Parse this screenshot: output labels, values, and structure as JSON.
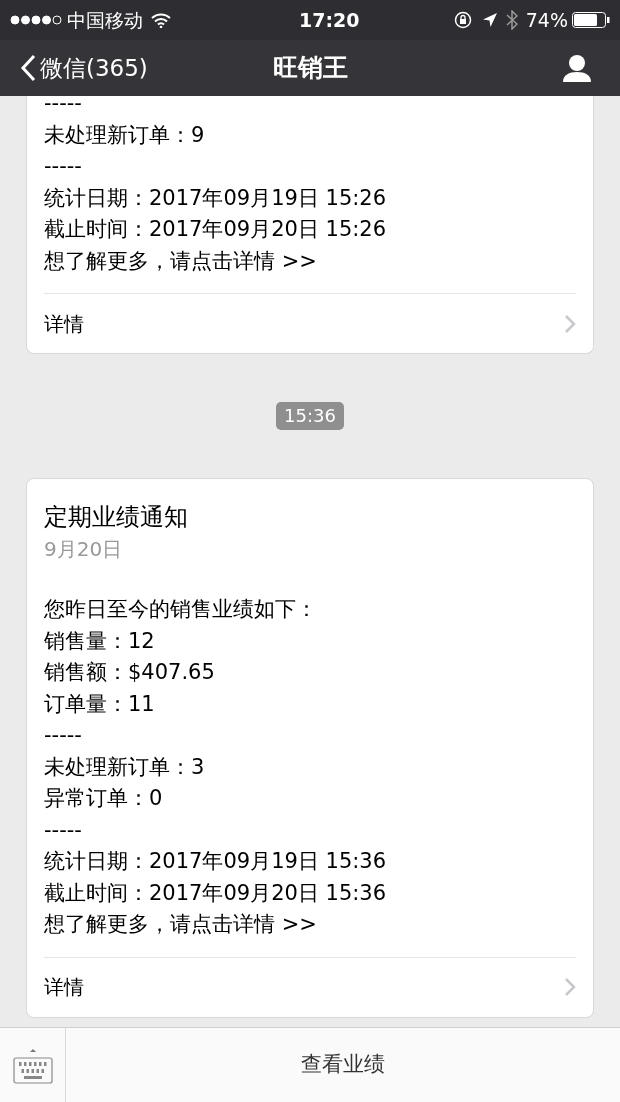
{
  "status_bar": {
    "carrier": "中国移动",
    "time": "17:20",
    "battery": "74%"
  },
  "nav": {
    "back": "微信(365)",
    "title": "旺销王"
  },
  "messages": [
    {
      "kind": "card",
      "cut_top": true,
      "lines": [
        "-----",
        "未处理新订单：9",
        "-----",
        "统计日期：2017年09月19日 15:26",
        "截止时间：2017年09月20日 15:26",
        "想了解更多，请点击详情 >>"
      ],
      "footer": "详情"
    },
    {
      "kind": "time",
      "text": "15:36"
    },
    {
      "kind": "card",
      "cut_top": false,
      "title": "定期业绩通知",
      "date": "9月20日",
      "lines": [
        "您昨日至今的销售业绩如下：",
        "销售量：12",
        "销售额：$407.65",
        "订单量：11",
        "-----",
        "未处理新订单：3",
        "异常订单：0",
        "-----",
        "统计日期：2017年09月19日 15:36",
        "截止时间：2017年09月20日 15:36",
        "想了解更多，请点击详情 >>"
      ],
      "footer": "详情"
    }
  ],
  "bottom_bar": {
    "button": "查看业绩"
  }
}
